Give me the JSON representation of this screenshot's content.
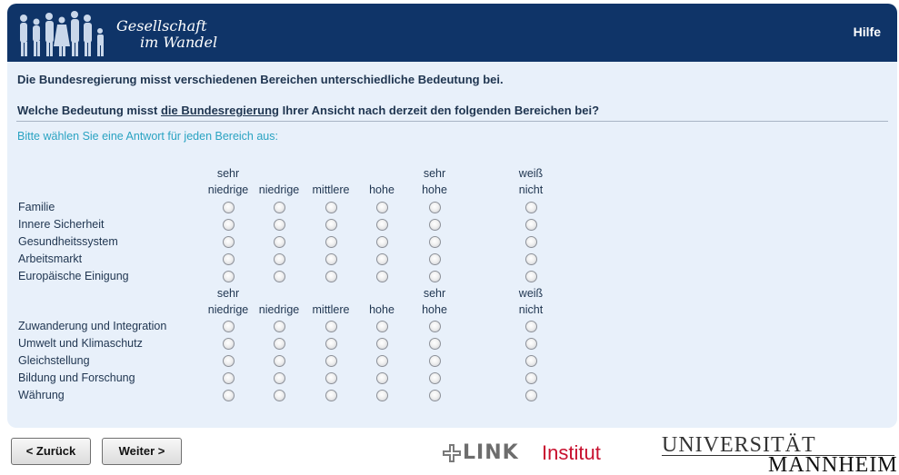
{
  "header": {
    "logo_line1": "Gesellschaft",
    "logo_line2": "im Wandel",
    "help_label": "Hilfe"
  },
  "survey": {
    "intro": "Die Bundesregierung misst verschiedenen Bereichen unterschiedliche Bedeutung bei.",
    "question_pre": "Welche Bedeutung misst ",
    "question_link": "die Bundesregierung",
    "question_post": " Ihrer Ansicht nach derzeit den folgenden Bereichen bei?",
    "instruction": "Bitte wählen Sie eine Antwort für jeden Bereich aus:",
    "columns": [
      {
        "line1": "sehr",
        "line2": "niedrige"
      },
      {
        "line1": "",
        "line2": "niedrige"
      },
      {
        "line1": "",
        "line2": "mittlere"
      },
      {
        "line1": "",
        "line2": "hohe"
      },
      {
        "line1": "sehr",
        "line2": "hohe"
      },
      {
        "line1": "weiß",
        "line2": "nicht"
      }
    ],
    "group1": [
      "Familie",
      "Innere Sicherheit",
      "Gesundheitssystem",
      "Arbeitsmarkt",
      "Europäische Einigung"
    ],
    "group2": [
      "Zuwanderung und Integration",
      "Umwelt und Klimaschutz",
      "Gleichstellung",
      "Bildung und Forschung",
      "Währung"
    ]
  },
  "nav": {
    "back_label": "< Zurück",
    "next_label": "Weiter >"
  },
  "footer": {
    "link_word": "LINK",
    "link_institut": "Institut",
    "uni_top": "UNIVERSITÄT",
    "uni_bottom": "MANNHEIM"
  },
  "colors": {
    "header_bg": "#0f3468",
    "panel_bg": "#e8f0fa",
    "instruction": "#2aa3c2",
    "link_red": "#c8102e"
  }
}
